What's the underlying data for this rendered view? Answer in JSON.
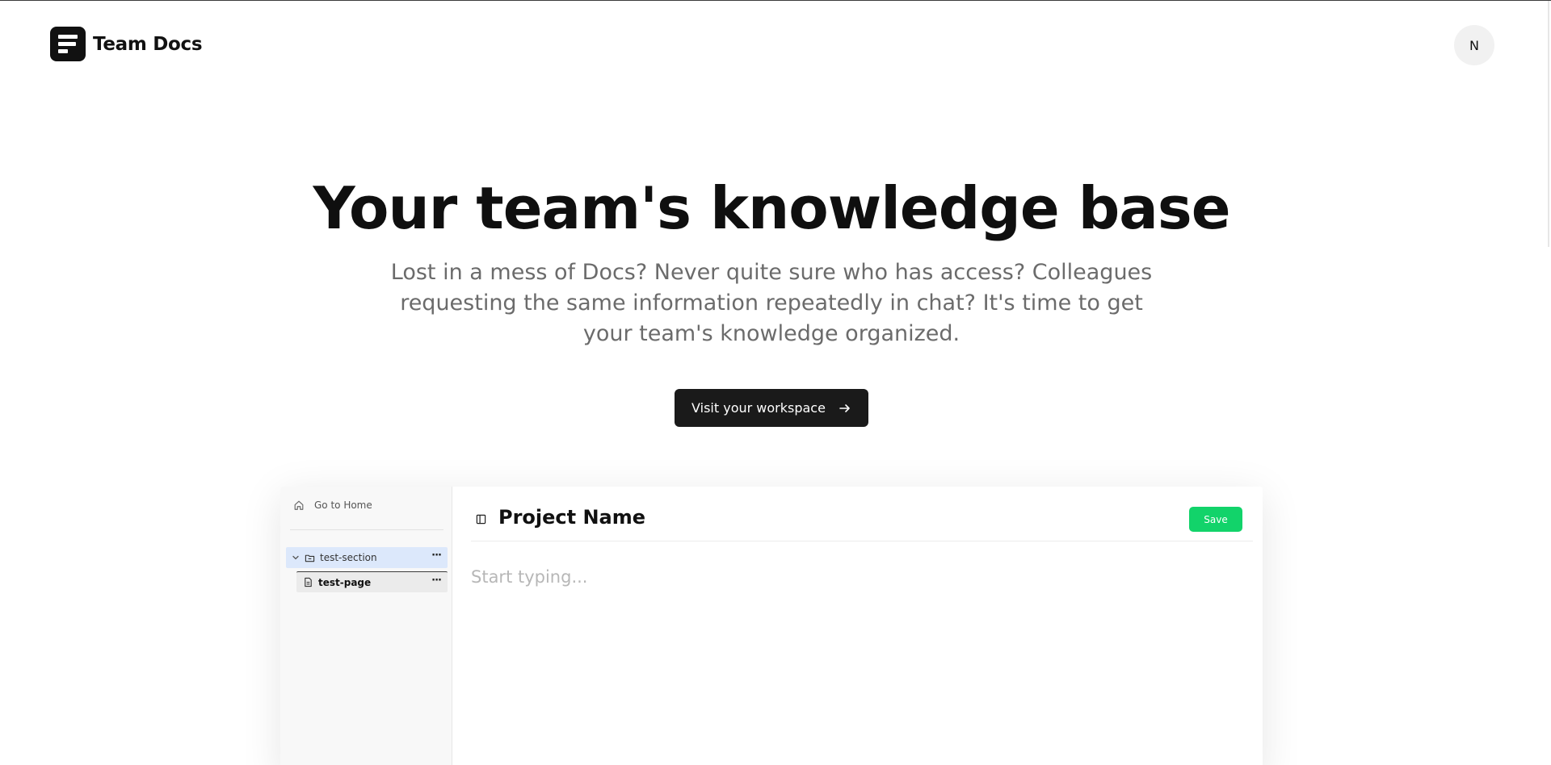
{
  "header": {
    "app_name": "Team Docs",
    "avatar_initial": "N"
  },
  "hero": {
    "title": "Your team's knowledge base",
    "subtitle": "Lost in a mess of Docs? Never quite sure who has access? Colleagues requesting the same information repeatedly in chat? It's time to get your team's knowledge organized.",
    "cta_label": "Visit your workspace"
  },
  "preview": {
    "sidebar": {
      "home_label": "Go to Home",
      "section_label": "test-section",
      "page_label": "test-page",
      "more_label": "···"
    },
    "editor": {
      "title": "Project Name",
      "save_label": "Save",
      "placeholder": "Start typing..."
    }
  },
  "colors": {
    "accent_save": "#12d36a",
    "cta_background": "#1a1a1a",
    "section_highlight": "#dce8fb"
  }
}
